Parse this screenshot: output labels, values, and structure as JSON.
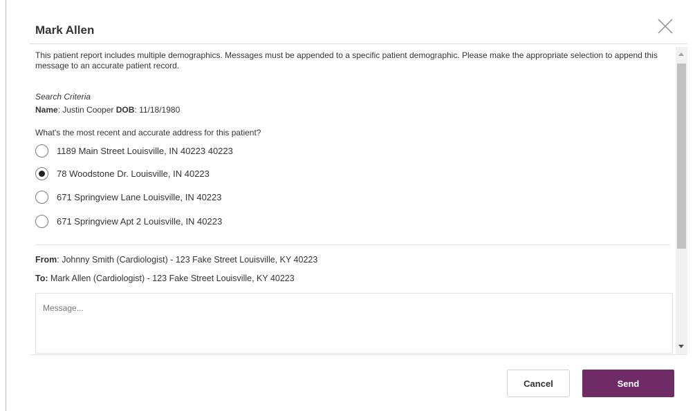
{
  "modal": {
    "title": "Mark Allen"
  },
  "intro_text": "This patient report includes multiple demographics. Messages must be appended to a specific patient demographic. Please make the appropriate selection to append this message to an accurate patient record.",
  "search_criteria": {
    "heading": "Search Criteria",
    "name_label": "Name",
    "name_value": ": Justin Cooper ",
    "dob_label": "DOB",
    "dob_value": ": 11/18/1980"
  },
  "question": "What's the most recent and accurate address for this patient?",
  "address_options": [
    {
      "label": "1189 Main Street Louisville, IN 40223 40223",
      "selected": false
    },
    {
      "label": "78 Woodstone Dr. Louisville, IN 40223",
      "selected": true
    },
    {
      "label": "671 Springview Lane Louisville, IN 40223",
      "selected": false
    },
    {
      "label": "671 Springview Apt 2 Louisville, IN 40223",
      "selected": false
    }
  ],
  "from": {
    "label": "From",
    "value": ": Johnny Smith (Cardiologist) - 123 Fake Street Louisville, KY 40223"
  },
  "to": {
    "label": "To:",
    "value": " Mark Allen (Cardiologist) - 123 Fake Street Louisville, KY 40223"
  },
  "message": {
    "placeholder": "Message...",
    "value": ""
  },
  "buttons": {
    "cancel": "Cancel",
    "send": "Send"
  },
  "icons": {
    "close": "close-icon",
    "radio": "radio-button-icon",
    "scroll_up": "chevron-up-icon",
    "scroll_down": "chevron-down-icon"
  },
  "colors": {
    "send_button": "#6e2b66",
    "text": "#333333"
  }
}
